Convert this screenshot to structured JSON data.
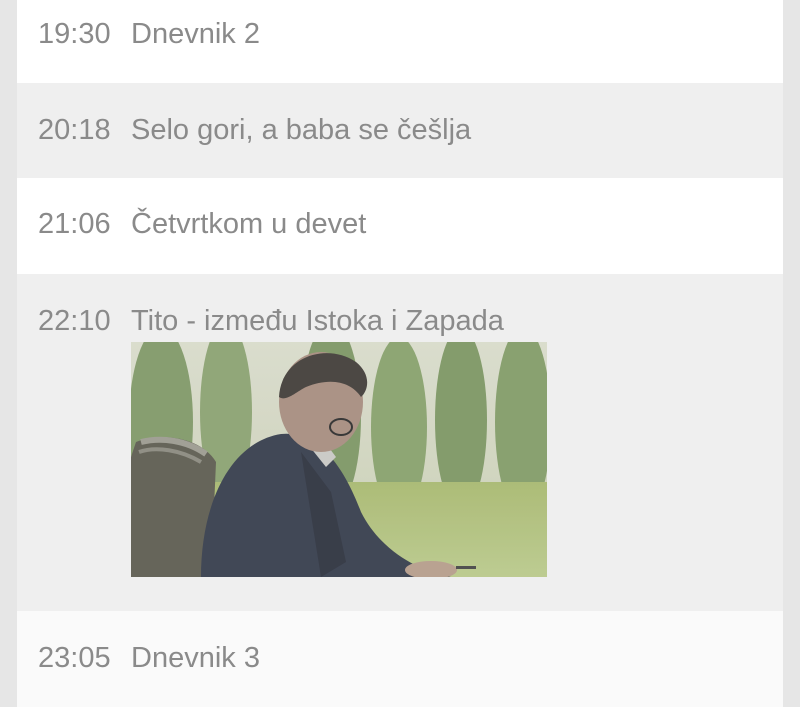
{
  "schedule": [
    {
      "time": "19:30",
      "title": "Dnevnik 2"
    },
    {
      "time": "20:18",
      "title": "Selo gori, a baba se češlja"
    },
    {
      "time": "21:06",
      "title": "Četvrtkom u devet"
    },
    {
      "time": "22:10",
      "title": "Tito - između Istoka i Zapada",
      "has_image": true
    },
    {
      "time": "23:05",
      "title": "Dnevnik 3"
    }
  ],
  "colors": {
    "page_background": "#e6e6e6",
    "row_white": "#ffffff",
    "row_grey": "#efefef",
    "text": "#8a8a8a"
  }
}
